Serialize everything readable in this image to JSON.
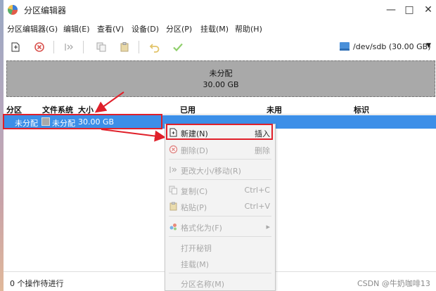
{
  "window": {
    "title": "分区编辑器"
  },
  "menubar": [
    "分区编辑器(G)",
    "编辑(E)",
    "查看(V)",
    "设备(D)",
    "分区(P)",
    "挂载(M)",
    "帮助(H)"
  ],
  "device": {
    "label": "/dev/sdb (30.00 GB)"
  },
  "graphic": {
    "name": "未分配",
    "size": "30.00 GB"
  },
  "table": {
    "headers": [
      "分区",
      "文件系统",
      "大小",
      "已用",
      "未用",
      "标识"
    ],
    "row": {
      "partition": "未分配",
      "filesystem": "未分配",
      "size": "30.00 GB"
    }
  },
  "context_menu": [
    {
      "label": "新建(N)",
      "shortcut": "插入",
      "icon": "new-partition-icon",
      "enabled": true
    },
    {
      "label": "删除(D)",
      "shortcut": "删除",
      "icon": "delete-icon",
      "enabled": false
    },
    {
      "label": "更改大小/移动(R)",
      "shortcut": "",
      "icon": "resize-icon",
      "enabled": false
    },
    {
      "label": "复制(C)",
      "shortcut": "Ctrl+C",
      "icon": "copy-icon",
      "enabled": false
    },
    {
      "label": "粘贴(P)",
      "shortcut": "Ctrl+V",
      "icon": "paste-icon",
      "enabled": false
    },
    {
      "label": "格式化为(F)",
      "shortcut": "▸",
      "icon": "format-icon",
      "enabled": false
    },
    {
      "label": "打开秘钥",
      "shortcut": "",
      "icon": "",
      "enabled": false
    },
    {
      "label": "挂载(M)",
      "shortcut": "",
      "icon": "",
      "enabled": false
    },
    {
      "label": "分区名称(M)",
      "shortcut": "",
      "icon": "",
      "enabled": false
    }
  ],
  "status": {
    "text": "0 个操作待进行"
  },
  "watermark": "CSDN @牛奶咖啡13",
  "colors": {
    "selection": "#3c8fe8",
    "highlight_box": "#e0202a",
    "unallocated": "#a9a9a9"
  }
}
